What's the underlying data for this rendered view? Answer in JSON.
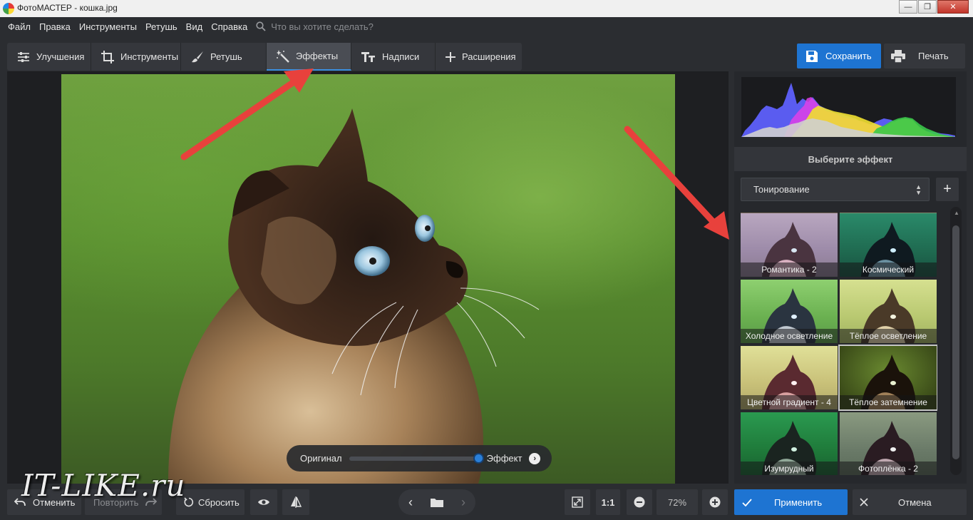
{
  "window": {
    "title": "ФотоМАСТЕР - кошка.jpg"
  },
  "menu": {
    "items": [
      "Файл",
      "Правка",
      "Инструменты",
      "Ретушь",
      "Вид",
      "Справка"
    ],
    "search_placeholder": "Что вы хотите сделать?"
  },
  "tabs": [
    {
      "label": "Улучшения",
      "icon": "sliders-icon"
    },
    {
      "label": "Инструменты",
      "icon": "crop-icon"
    },
    {
      "label": "Ретушь",
      "icon": "brush-icon"
    },
    {
      "label": "Эффекты",
      "icon": "magic-wand-icon",
      "active": true
    },
    {
      "label": "Надписи",
      "icon": "text-icon"
    },
    {
      "label": "Расширения",
      "icon": "plus-icon"
    }
  ],
  "toolbar": {
    "save_label": "Сохранить",
    "print_label": "Печать"
  },
  "compare": {
    "original_label": "Оригинал",
    "effect_label": "Эффект",
    "position": 1.0
  },
  "right_panel": {
    "header": "Выберите эффект",
    "category": "Тонирование",
    "effects": [
      {
        "label": "Романтика - 2"
      },
      {
        "label": "Космический"
      },
      {
        "label": "Холодное осветление"
      },
      {
        "label": "Тёплое осветление"
      },
      {
        "label": "Цветной градиент - 4"
      },
      {
        "label": "Тёплое затемнение",
        "selected": true
      },
      {
        "label": "Изумрудный"
      },
      {
        "label": "Фотоплёнка - 2"
      }
    ]
  },
  "bottom": {
    "undo_label": "Отменить",
    "redo_label": "Повторить",
    "reset_label": "Сбросить",
    "zoom_one": "1:1",
    "zoom_value": "72%",
    "apply_label": "Применить",
    "cancel_label": "Отмена"
  },
  "watermark": "IT-LIKE.ru",
  "colors": {
    "accent": "#1e74d2",
    "annotation_arrow": "#e8413c",
    "background": "#2b2d31"
  }
}
